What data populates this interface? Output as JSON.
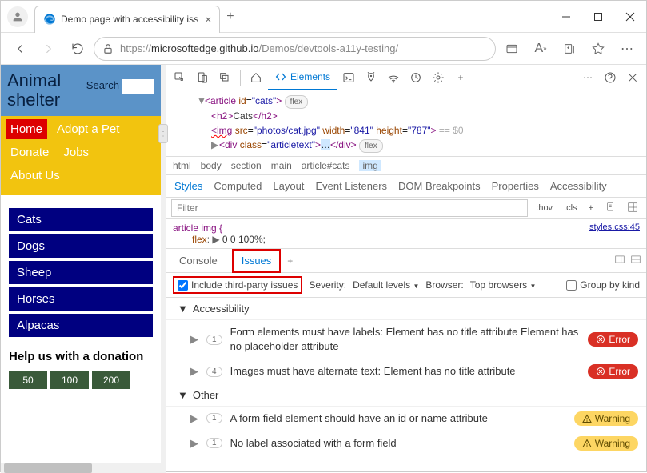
{
  "browser": {
    "tab_title": "Demo page with accessibility iss",
    "url": {
      "prefix": "https://",
      "host": "microsoftedge.github.io",
      "path": "/Demos/devtools-a11y-testing/"
    }
  },
  "page": {
    "title": "Animal shelter",
    "search_label": "Search",
    "nav": [
      "Home",
      "Adopt a Pet",
      "Donate",
      "Jobs",
      "About Us"
    ],
    "sidebar": [
      "Cats",
      "Dogs",
      "Sheep",
      "Horses",
      "Alpacas"
    ],
    "help_title": "Help us with a donation",
    "donate": [
      "50",
      "100",
      "200"
    ]
  },
  "devtools": {
    "main_tabs": {
      "elements": "Elements"
    },
    "dom": {
      "article_open": "<article id=\"cats\">",
      "h2": "Cats",
      "img": {
        "src": "photos/cat.jpg",
        "width": "841",
        "height": "787",
        "dim": "== $0"
      },
      "div": {
        "class": "articletext"
      },
      "flex": "flex"
    },
    "breadcrumb": [
      "html",
      "body",
      "section",
      "main",
      "article#cats",
      "img"
    ],
    "styles_tabs": [
      "Styles",
      "Computed",
      "Layout",
      "Event Listeners",
      "DOM Breakpoints",
      "Properties",
      "Accessibility"
    ],
    "filter_placeholder": "Filter",
    "filter_buttons": [
      ":hov",
      ".cls"
    ],
    "css": {
      "selector": "article img {",
      "prop_name": "flex",
      "prop_val": "0 0 100%;",
      "link": "styles.css:45"
    },
    "drawer": {
      "tabs": [
        "Console",
        "Issues"
      ]
    },
    "issues_filter": {
      "checkbox": "Include third-party issues",
      "severity_lbl": "Severity:",
      "severity_val": "Default levels",
      "browser_lbl": "Browser:",
      "browser_val": "Top browsers",
      "group_lbl": "Group by kind"
    },
    "issues": {
      "groups": [
        {
          "name": "Accessibility",
          "items": [
            {
              "count": "1",
              "text": "Form elements must have labels: Element has no title attribute Element has no placeholder attribute",
              "badge": "Error"
            },
            {
              "count": "4",
              "text": "Images must have alternate text: Element has no title attribute",
              "badge": "Error"
            }
          ]
        },
        {
          "name": "Other",
          "items": [
            {
              "count": "1",
              "text": "A form field element should have an id or name attribute",
              "badge": "Warning"
            },
            {
              "count": "1",
              "text": "No label associated with a form field",
              "badge": "Warning"
            }
          ]
        }
      ]
    }
  }
}
